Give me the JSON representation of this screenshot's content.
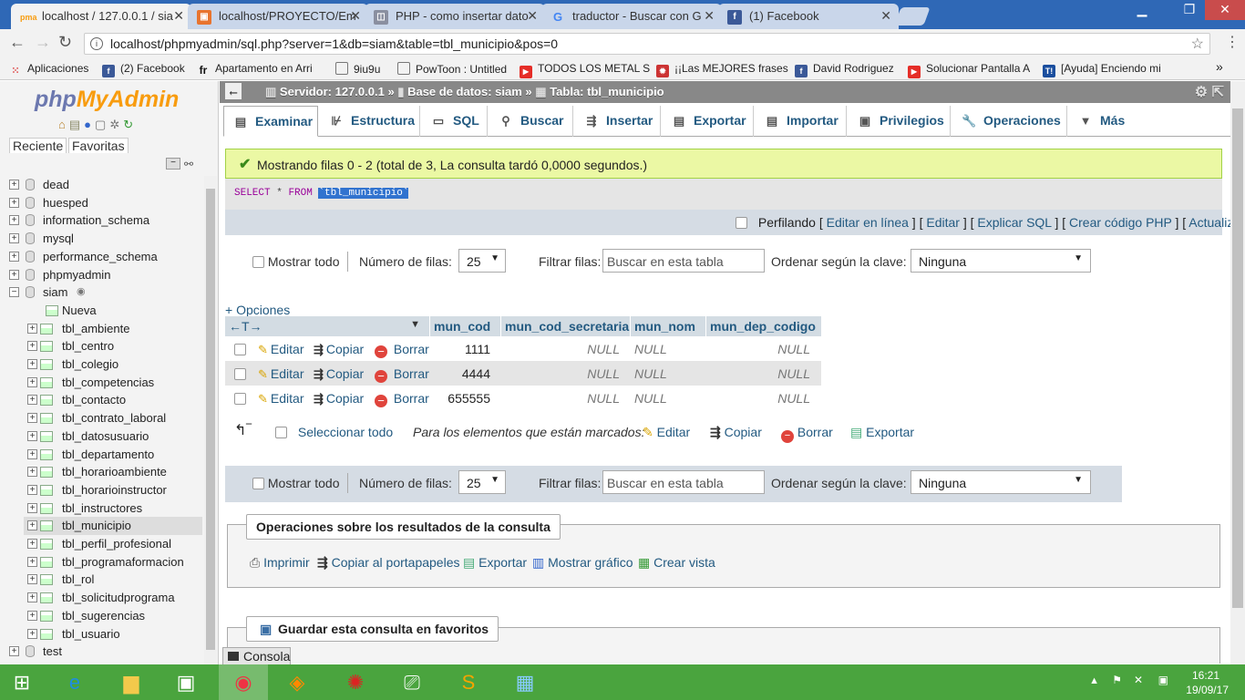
{
  "browser": {
    "tabs": [
      {
        "title": "localhost / 127.0.0.1 / sia",
        "icon": "phpmyadmin-icon",
        "active": true
      },
      {
        "title": "localhost/PROYECTO/Em",
        "icon": "generic-page-icon"
      },
      {
        "title": "PHP - como insertar dato",
        "icon": "stackoverflow-icon"
      },
      {
        "title": "traductor - Buscar con G",
        "icon": "google-icon"
      },
      {
        "title": "(1) Facebook",
        "icon": "facebook-icon"
      }
    ],
    "url": "localhost/phpmyadmin/sql.php?server=1&db=siam&table=tbl_municipio&pos=0",
    "bookmarks": [
      {
        "label": "Aplicaciones",
        "icon": "apps-grid-icon"
      },
      {
        "label": "(2) Facebook",
        "icon": "facebook-icon"
      },
      {
        "label": "Apartamento en Arri",
        "icon": "fr-icon"
      },
      {
        "label": "9iu9u",
        "icon": "page-icon"
      },
      {
        "label": "PowToon : Untitled",
        "icon": "page-icon"
      },
      {
        "label": "TODOS LOS METAL S",
        "icon": "youtube-icon"
      },
      {
        "label": "¡¡Las MEJORES frases",
        "icon": "fire-icon"
      },
      {
        "label": "David Rodriguez",
        "icon": "facebook-icon"
      },
      {
        "label": "Solucionar Pantalla A",
        "icon": "youtube-icon"
      },
      {
        "label": "[Ayuda] Enciendo mi",
        "icon": "t-icon"
      }
    ]
  },
  "sidebar": {
    "logo_php": "php",
    "logo_admin": "MyAdmin",
    "tab_recent": "Reciente",
    "tab_favorites": "Favoritas",
    "databases": [
      "dead",
      "huesped",
      "information_schema",
      "mysql",
      "performance_schema",
      "phpmyadmin",
      "siam"
    ],
    "new_label": "Nueva",
    "tables": [
      "tbl_ambiente",
      "tbl_centro",
      "tbl_colegio",
      "tbl_competencias",
      "tbl_contacto",
      "tbl_contrato_laboral",
      "tbl_datosusuario",
      "tbl_departamento",
      "tbl_horarioambiente",
      "tbl_horarioinstructor",
      "tbl_instructores",
      "tbl_municipio",
      "tbl_perfil_profesional",
      "tbl_programaformacion",
      "tbl_rol",
      "tbl_solicitudprograma",
      "tbl_sugerencias",
      "tbl_usuario"
    ],
    "selected_table": "tbl_municipio",
    "last_db": "test"
  },
  "breadcrumb": {
    "server": "Servidor: 127.0.0.1",
    "database": "Base de datos: siam",
    "table": "Tabla: tbl_municipio"
  },
  "menu": [
    {
      "label": "Examinar",
      "icon": "browse-icon"
    },
    {
      "label": "Estructura",
      "icon": "structure-icon"
    },
    {
      "label": "SQL",
      "icon": "sql-icon"
    },
    {
      "label": "Buscar",
      "icon": "search-icon"
    },
    {
      "label": "Insertar",
      "icon": "insert-icon"
    },
    {
      "label": "Exportar",
      "icon": "export-icon"
    },
    {
      "label": "Importar",
      "icon": "import-icon"
    },
    {
      "label": "Privilegios",
      "icon": "privileges-icon"
    },
    {
      "label": "Operaciones",
      "icon": "wrench-icon"
    },
    {
      "label": "Más",
      "icon": "chevron-down-icon"
    }
  ],
  "message": "Mostrando filas 0 - 2 (total de 3, La consulta tardó 0,0000 segundos.)",
  "sql": {
    "select": "SELECT",
    "star": "*",
    "from": "FROM",
    "table": "`tbl_municipio`"
  },
  "profiling": {
    "label": "Perfilando",
    "links": [
      "Editar en línea",
      "Editar",
      "Explicar SQL",
      "Crear código PHP",
      "Actualizar"
    ]
  },
  "nav": {
    "show_all": "Mostrar todo",
    "rows_label": "Número de filas:",
    "rows_value": "25",
    "filter_label": "Filtrar filas:",
    "filter_placeholder": "Buscar en esta tabla",
    "sort_label": "Ordenar según la clave:",
    "sort_value": "Ninguna"
  },
  "options_link": "+ Opciones",
  "table": {
    "columns": [
      "mun_cod",
      "mun_cod_secretaria",
      "mun_nom",
      "mun_dep_codigo"
    ],
    "actions": {
      "edit": "Editar",
      "copy": "Copiar",
      "delete": "Borrar"
    },
    "rows": [
      {
        "mun_cod": "1111",
        "mun_cod_secretaria": "NULL",
        "mun_nom": "NULL",
        "mun_dep_codigo": "NULL"
      },
      {
        "mun_cod": "4444",
        "mun_cod_secretaria": "NULL",
        "mun_nom": "NULL",
        "mun_dep_codigo": "NULL"
      },
      {
        "mun_cod": "655555",
        "mun_cod_secretaria": "NULL",
        "mun_nom": "NULL",
        "mun_dep_codigo": "NULL"
      }
    ]
  },
  "bulk": {
    "select_all": "Seleccionar todo",
    "marked_label": "Para los elementos que están marcados:",
    "edit": "Editar",
    "copy": "Copiar",
    "delete": "Borrar",
    "export": "Exportar"
  },
  "query_ops": {
    "legend": "Operaciones sobre los resultados de la consulta",
    "items": [
      "Imprimir",
      "Copiar al portapapeles",
      "Exportar",
      "Mostrar gráfico",
      "Crear vista"
    ]
  },
  "favorites": {
    "legend": "Guardar esta consulta en favoritos"
  },
  "console": {
    "label": "Consola"
  },
  "taskbar": {
    "time": "16:21",
    "date": "19/09/17"
  },
  "colors": {
    "link": "#235a81",
    "success_bg": "#ebf8a4",
    "taskbar": "#4aa43e",
    "tabstrip": "#2f68b6"
  }
}
